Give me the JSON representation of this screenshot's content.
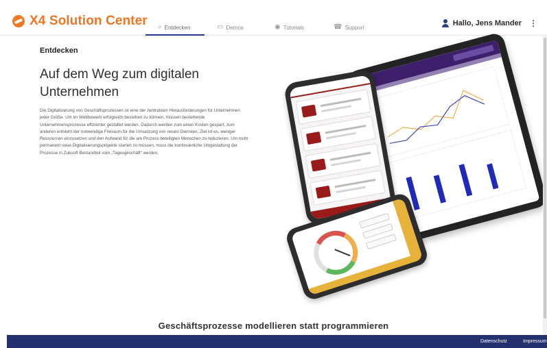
{
  "header": {
    "brand": "X4 Solution Center",
    "nav": [
      {
        "label": "Entdecken",
        "icon": "search-icon",
        "glyph": "⌕",
        "active": true
      },
      {
        "label": "Demos",
        "icon": "monitor-icon",
        "glyph": "▭",
        "active": false
      },
      {
        "label": "Tutorials",
        "icon": "play-circle-icon",
        "glyph": "◉",
        "active": false
      },
      {
        "label": "Support",
        "icon": "phone-icon",
        "glyph": "☎",
        "active": false
      }
    ],
    "user_greeting": "Hallo, Jens Mander",
    "menu_glyph": "⋮"
  },
  "main": {
    "section_label": "Entdecken",
    "headline": "Auf dem Weg zum digitalen Unternehmen",
    "intro": "Die Digitalisierung von Geschäftsprozessen ist eine der zentralsten Herausforderungen für Unternehmen jeder Größe. Um im Wettbewerb erfolgreich bestehen zu können, müssen bestehende Unternehmensprozesse effizienter gestaltet werden. Dadurch werden zum einen Kosten gespart, zum anderen entsteht der notwendige Freiraum für die Umsetzung von neuen Diensten. Ziel ist es, weniger Ressourcen einzusetzen und den Aufwand für die am Prozess beteiligten Menschen zu reduzieren. Um nicht permanent neue Digitalisierungsprojekte starten zu müssen, muss die kontinuierliche Umgestaltung der Prozesse in Zukunft Bestandteil vom „Tagesgeschäft“ werden.",
    "subheadline": "Geschäftsprozesse modellieren statt programmieren"
  },
  "footer": {
    "links": [
      "Datenschutz",
      "Impressum"
    ]
  },
  "colors": {
    "brand_orange": "#ee7623",
    "nav_active": "#26368a",
    "footer_bg": "#25316f"
  }
}
